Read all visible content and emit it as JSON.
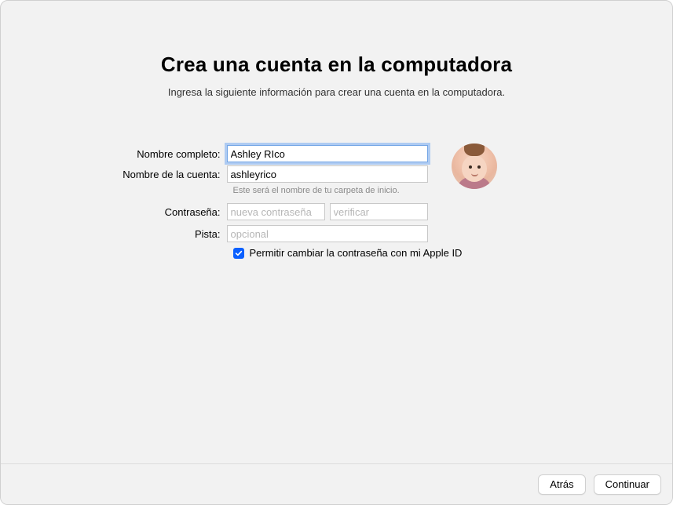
{
  "header": {
    "title": "Crea una cuenta en la computadora",
    "subtitle": "Ingresa la siguiente información para crear una cuenta en la computadora."
  },
  "form": {
    "full_name": {
      "label": "Nombre completo:",
      "value": "Ashley RIco"
    },
    "account_name": {
      "label": "Nombre de la cuenta:",
      "value": "ashleyrico",
      "helper": "Este será el nombre de tu carpeta de inicio."
    },
    "password": {
      "label": "Contraseña:",
      "new_placeholder": "nueva contraseña",
      "verify_placeholder": "verificar"
    },
    "hint": {
      "label": "Pista:",
      "placeholder": "opcional"
    },
    "allow_reset": {
      "checked": true,
      "label": "Permitir cambiar la contraseña con mi Apple ID"
    }
  },
  "avatar": {
    "name": "user-memoji"
  },
  "footer": {
    "back": "Atrás",
    "continue": "Continuar"
  }
}
